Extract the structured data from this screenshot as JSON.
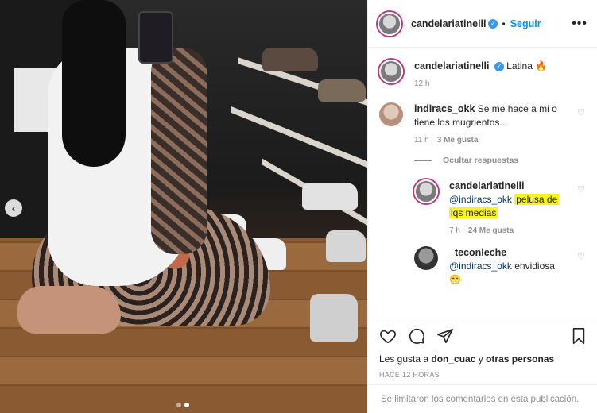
{
  "header": {
    "username": "candelariatinelli",
    "follow_label": "Seguir",
    "more_label": "•••"
  },
  "caption": {
    "username": "candelariatinelli",
    "text": "Latina",
    "emoji": "🔥",
    "time": "12 h"
  },
  "comments": [
    {
      "username": "indiracs_okk",
      "text": "Se me hace a mi o tiene los mugrientos...",
      "time": "11 h",
      "likes": "3 Me gusta"
    }
  ],
  "hide_replies_label": "Ocultar respuestas",
  "replies": [
    {
      "username": "candelariatinelli",
      "mention": "@indiracs_okk",
      "text_part1": "pelusa de",
      "text_part2": "lqs medias",
      "time": "7 h",
      "likes": "24 Me gusta"
    },
    {
      "username": "_teconleche",
      "mention": "@indiracs_okk",
      "text": "envidiosa",
      "emoji": "😁"
    }
  ],
  "likes_line": {
    "prefix": "Les gusta a",
    "user": "don_cuac",
    "middle": "y",
    "others": "otras personas"
  },
  "timestamp": "HACE 12 HORAS",
  "footer_text": "Se limitaron los comentarios en esta publicación.",
  "icons": {
    "heart": "heart-icon",
    "comment": "comment-icon",
    "share": "share-icon",
    "save": "bookmark-icon",
    "verified": "verified-icon"
  },
  "colors": {
    "accent": "#0095f6",
    "verified": "#3897f0",
    "highlight": "#f7f416",
    "muted": "#8e8e8e"
  }
}
